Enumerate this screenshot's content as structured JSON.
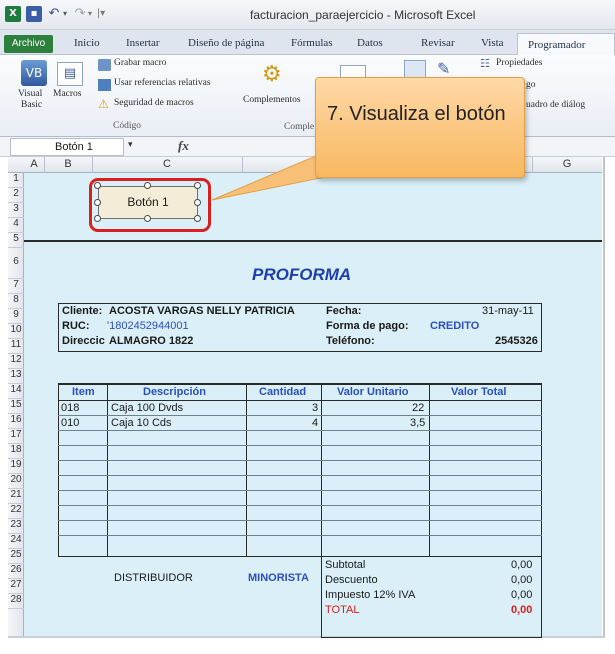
{
  "titlebar": {
    "app_icon": "excel-icon",
    "title": "facturacion_paraejercicio - Microsoft Excel"
  },
  "tabs": [
    {
      "label": "Archivo"
    },
    {
      "label": "Inicio"
    },
    {
      "label": "Insertar"
    },
    {
      "label": "Diseño de página"
    },
    {
      "label": "Fórmulas"
    },
    {
      "label": "Datos"
    },
    {
      "label": "Revisar"
    },
    {
      "label": "Vista"
    },
    {
      "label": "Programador"
    }
  ],
  "ribbon": {
    "visual_basic": [
      "Visual",
      "Basic"
    ],
    "macros": "Macros",
    "grabar_macro": "Grabar macro",
    "usar_referencias": "Usar referencias relativas",
    "seguridad_macros": "Seguridad de macros",
    "group_codigo": "Código",
    "complementos": "Complementos",
    "group_complementos_partial": "Comple",
    "propiedades": "Propiedades",
    "codigo_partial": "go",
    "cuadro_partial": "uadro de diálog"
  },
  "formula_bar": {
    "name_box": "Botón 1",
    "fx_label": "fx"
  },
  "grid": {
    "columns": [
      "A",
      "B",
      "C",
      "G"
    ],
    "rows": [
      "1",
      "2",
      "3",
      "4",
      "5",
      "6",
      "7",
      "8",
      "9",
      "10",
      "11",
      "12",
      "13",
      "14",
      "15",
      "16",
      "17",
      "18",
      "19",
      "20",
      "21",
      "22",
      "23",
      "24",
      "25",
      "26",
      "27",
      "28"
    ]
  },
  "sheet": {
    "button_label": "Botón 1",
    "proforma_title": "PROFORMA",
    "cliente_label": "Cliente:",
    "cliente_value": "ACOSTA VARGAS NELLY PATRICIA",
    "ruc_label": "RUC:",
    "ruc_value": "'1802452944001",
    "direccion_label": "Direccic",
    "direccion_value": "ALMAGRO 1822",
    "fecha_label": "Fecha:",
    "fecha_value": "31-may-11",
    "forma_pago_label": "Forma de pago:",
    "forma_pago_value": "CREDITO",
    "telefono_label": "Teléfono:",
    "telefono_value": "2545326",
    "table_headers": [
      "Item",
      "Descripción",
      "Cantidad",
      "Valor Unitario",
      "Valor Total"
    ],
    "items": [
      {
        "item": "018",
        "descripcion": "Caja 100 Dvds",
        "cantidad": "3",
        "valor_unitario": "22"
      },
      {
        "item": "010",
        "descripcion": "Caja 10 Cds",
        "cantidad": "4",
        "valor_unitario": "3,5"
      }
    ],
    "distribuidor": "DISTRIBUIDOR",
    "minorista": "MINORISTA",
    "totals": [
      {
        "label": "Subtotal",
        "value": "0,00"
      },
      {
        "label": "Descuento",
        "value": "0,00"
      },
      {
        "label": "Impuesto 12% IVA",
        "value": "0,00"
      },
      {
        "label": "TOTAL",
        "value": "0,00"
      }
    ]
  },
  "callout": {
    "text": "7. Visualiza el botón"
  },
  "colors": {
    "accent_red": "#d8201c",
    "proforma_blue": "#1d3fae",
    "callout_orange": "#f7b860",
    "sheet_background": "#daeff7"
  }
}
